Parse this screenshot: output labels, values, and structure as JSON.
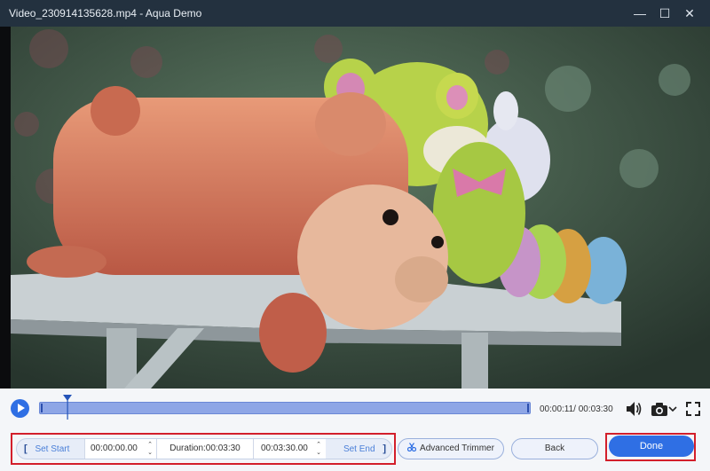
{
  "window": {
    "title": "Video_230914135628.mp4  -  Aqua Demo",
    "minimize_glyph": "—",
    "maximize_glyph": "☐",
    "close_glyph": "✕"
  },
  "player": {
    "time_readout": "00:00:11/ 00:03:30",
    "progress_fraction": 0.052,
    "icons": [
      "play-icon",
      "volume-icon",
      "camera-icon",
      "chevron-down-icon",
      "fullscreen-icon"
    ]
  },
  "trim": {
    "set_start_bracket": "[",
    "set_start_label": "Set Start",
    "start_time": "00:00:00.00",
    "duration": "Duration:00:03:30",
    "end_time": "00:03:30.00",
    "set_end_label": "Set End",
    "set_end_bracket": "]"
  },
  "buttons": {
    "advanced_trimmer": "Advanced Trimmer",
    "back": "Back",
    "done": "Done"
  },
  "colors": {
    "accent": "#2f6fe4",
    "highlight_outline": "#d31f2b",
    "titlebar": "#23313f"
  }
}
